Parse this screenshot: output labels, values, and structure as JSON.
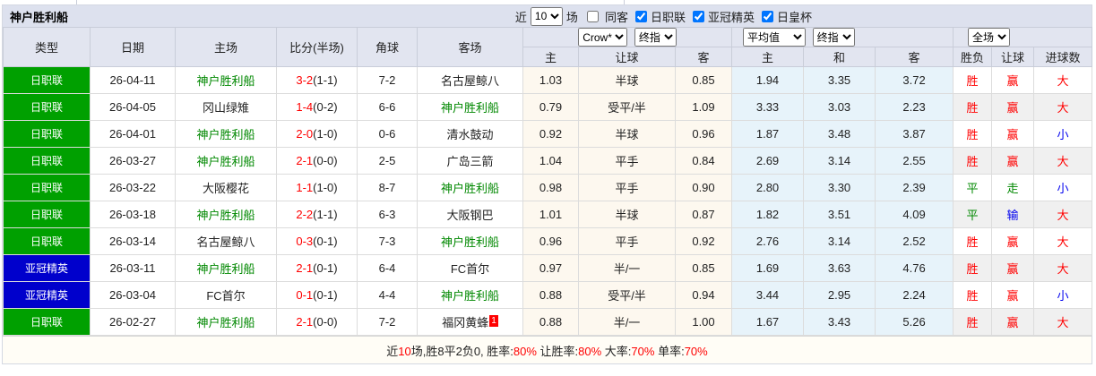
{
  "title": "神户胜利船",
  "filter_bar": {
    "near_label": "近",
    "matches_count": "10",
    "matches_label": "场",
    "checkboxes": [
      {
        "label": "同客",
        "checked": false
      },
      {
        "label": "日职联",
        "checked": true
      },
      {
        "label": "亚冠精英",
        "checked": true
      },
      {
        "label": "日皇杯",
        "checked": true
      }
    ]
  },
  "table": {
    "left_headers": [
      "类型",
      "日期",
      "主场",
      "比分(半场)",
      "角球",
      "客场"
    ],
    "selects": {
      "bookmaker": "Crow*",
      "final1": "终指",
      "average": "平均值",
      "final2": "终指",
      "full_match": "全场"
    },
    "sub_headers": [
      "主",
      "让球",
      "客",
      "主",
      "和",
      "客",
      "胜负",
      "让球",
      "进球数"
    ],
    "rows": [
      {
        "type": "日职联",
        "type_color": "green",
        "date": "26-04-11",
        "home": "神户胜利船",
        "home_highlight": true,
        "score": "3-2",
        "half": "(1-1)",
        "corners": "7-2",
        "away": "名古屋鲸八",
        "away_highlight": false,
        "away_badge": "",
        "handicap_home": "1.03",
        "handicap": "半球",
        "handicap_away": "0.85",
        "avg_home": "1.94",
        "avg_draw": "3.35",
        "avg_away": "3.72",
        "result": "胜",
        "result_color": "red",
        "handicap_result": "赢",
        "handicap_result_color": "red",
        "goals": "大",
        "goals_color": "red"
      },
      {
        "type": "日职联",
        "type_color": "green",
        "date": "26-04-05",
        "home": "冈山绿雉",
        "home_highlight": false,
        "score": "1-4",
        "half": "(0-2)",
        "corners": "6-6",
        "away": "神户胜利船",
        "away_highlight": true,
        "away_badge": "",
        "handicap_home": "0.79",
        "handicap": "受平/半",
        "handicap_away": "1.09",
        "avg_home": "3.33",
        "avg_draw": "3.03",
        "avg_away": "2.23",
        "result": "胜",
        "result_color": "red",
        "handicap_result": "赢",
        "handicap_result_color": "red",
        "goals": "大",
        "goals_color": "red"
      },
      {
        "type": "日职联",
        "type_color": "green",
        "date": "26-04-01",
        "home": "神户胜利船",
        "home_highlight": true,
        "score": "2-0",
        "half": "(1-0)",
        "corners": "0-6",
        "away": "清水鼓动",
        "away_highlight": false,
        "away_badge": "",
        "handicap_home": "0.92",
        "handicap": "半球",
        "handicap_away": "0.96",
        "avg_home": "1.87",
        "avg_draw": "3.48",
        "avg_away": "3.87",
        "result": "胜",
        "result_color": "red",
        "handicap_result": "赢",
        "handicap_result_color": "red",
        "goals": "小",
        "goals_color": "blue"
      },
      {
        "type": "日职联",
        "type_color": "green",
        "date": "26-03-27",
        "home": "神户胜利船",
        "home_highlight": true,
        "score": "2-1",
        "half": "(0-0)",
        "corners": "2-5",
        "away": "广岛三箭",
        "away_highlight": false,
        "away_badge": "",
        "handicap_home": "1.04",
        "handicap": "平手",
        "handicap_away": "0.84",
        "avg_home": "2.69",
        "avg_draw": "3.14",
        "avg_away": "2.55",
        "result": "胜",
        "result_color": "red",
        "handicap_result": "赢",
        "handicap_result_color": "red",
        "goals": "大",
        "goals_color": "red"
      },
      {
        "type": "日职联",
        "type_color": "green",
        "date": "26-03-22",
        "home": "大阪樱花",
        "home_highlight": false,
        "score": "1-1",
        "half": "(1-0)",
        "corners": "8-7",
        "away": "神户胜利船",
        "away_highlight": true,
        "away_badge": "",
        "handicap_home": "0.98",
        "handicap": "平手",
        "handicap_away": "0.90",
        "avg_home": "2.80",
        "avg_draw": "3.30",
        "avg_away": "2.39",
        "result": "平",
        "result_color": "green",
        "handicap_result": "走",
        "handicap_result_color": "green",
        "goals": "小",
        "goals_color": "blue"
      },
      {
        "type": "日职联",
        "type_color": "green",
        "date": "26-03-18",
        "home": "神户胜利船",
        "home_highlight": true,
        "score": "2-2",
        "half": "(1-1)",
        "corners": "6-3",
        "away": "大阪钢巴",
        "away_highlight": false,
        "away_badge": "",
        "handicap_home": "1.01",
        "handicap": "半球",
        "handicap_away": "0.87",
        "avg_home": "1.82",
        "avg_draw": "3.51",
        "avg_away": "4.09",
        "result": "平",
        "result_color": "green",
        "handicap_result": "输",
        "handicap_result_color": "blue",
        "goals": "大",
        "goals_color": "red"
      },
      {
        "type": "日职联",
        "type_color": "green",
        "date": "26-03-14",
        "home": "名古屋鲸八",
        "home_highlight": false,
        "score": "0-3",
        "half": "(0-1)",
        "corners": "7-3",
        "away": "神户胜利船",
        "away_highlight": true,
        "away_badge": "",
        "handicap_home": "0.96",
        "handicap": "平手",
        "handicap_away": "0.92",
        "avg_home": "2.76",
        "avg_draw": "3.14",
        "avg_away": "2.52",
        "result": "胜",
        "result_color": "red",
        "handicap_result": "赢",
        "handicap_result_color": "red",
        "goals": "大",
        "goals_color": "red"
      },
      {
        "type": "亚冠精英",
        "type_color": "blue",
        "date": "26-03-11",
        "home": "神户胜利船",
        "home_highlight": true,
        "score": "2-1",
        "half": "(0-1)",
        "corners": "6-4",
        "away": "FC首尔",
        "away_highlight": false,
        "away_badge": "",
        "handicap_home": "0.97",
        "handicap": "半/一",
        "handicap_away": "0.85",
        "avg_home": "1.69",
        "avg_draw": "3.63",
        "avg_away": "4.76",
        "result": "胜",
        "result_color": "red",
        "handicap_result": "赢",
        "handicap_result_color": "red",
        "goals": "大",
        "goals_color": "red"
      },
      {
        "type": "亚冠精英",
        "type_color": "blue",
        "date": "26-03-04",
        "home": "FC首尔",
        "home_highlight": false,
        "score": "0-1",
        "half": "(0-1)",
        "corners": "4-4",
        "away": "神户胜利船",
        "away_highlight": true,
        "away_badge": "",
        "handicap_home": "0.88",
        "handicap": "受平/半",
        "handicap_away": "0.94",
        "avg_home": "3.44",
        "avg_draw": "2.95",
        "avg_away": "2.24",
        "result": "胜",
        "result_color": "red",
        "handicap_result": "赢",
        "handicap_result_color": "red",
        "goals": "小",
        "goals_color": "blue"
      },
      {
        "type": "日职联",
        "type_color": "green",
        "date": "26-02-27",
        "home": "神户胜利船",
        "home_highlight": true,
        "score": "2-1",
        "half": "(0-0)",
        "corners": "7-2",
        "away": "福冈黄蜂",
        "away_highlight": false,
        "away_badge": "1",
        "handicap_home": "0.88",
        "handicap": "半/一",
        "handicap_away": "1.00",
        "avg_home": "1.67",
        "avg_draw": "3.43",
        "avg_away": "5.26",
        "result": "胜",
        "result_color": "red",
        "handicap_result": "赢",
        "handicap_result_color": "red",
        "goals": "大",
        "goals_color": "red"
      }
    ]
  },
  "footer": {
    "segments": [
      {
        "text": "近",
        "red": false
      },
      {
        "text": "10",
        "red": true
      },
      {
        "text": "场,胜8平2负0, 胜率:",
        "red": false
      },
      {
        "text": "80%",
        "red": true
      },
      {
        "text": " 让胜率:",
        "red": false
      },
      {
        "text": "80%",
        "red": true
      },
      {
        "text": " 大率:",
        "red": false
      },
      {
        "text": "70%",
        "red": true
      },
      {
        "text": " 单率:",
        "red": false
      },
      {
        "text": "70%",
        "red": true
      }
    ]
  },
  "colors": {
    "league_green": "#00a000",
    "league_blue": "#0000cc",
    "team_green": "#008800",
    "win_red": "#ff0000",
    "draw_green": "#008800",
    "lose_blue": "#0000ee",
    "crow_bg": "#fdf8ef",
    "avg_bg": "#e7f3fa"
  }
}
